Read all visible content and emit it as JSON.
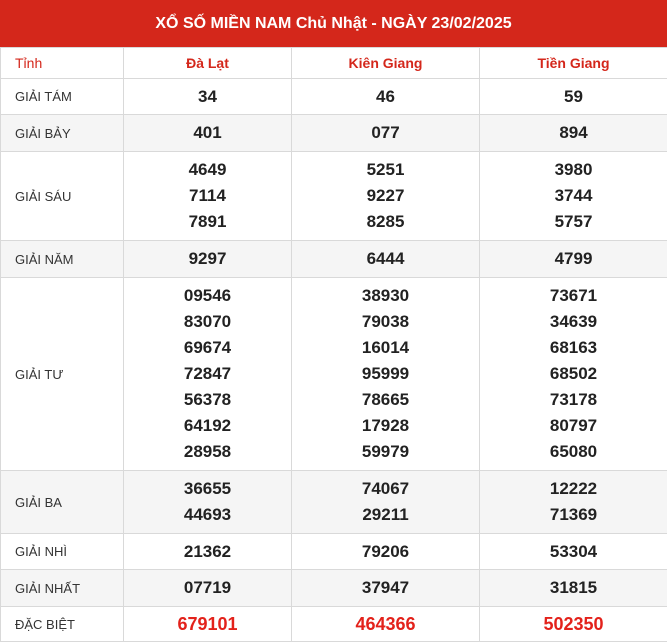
{
  "header": {
    "title": "XỔ SỐ MIỀN NAM Chủ Nhật - NGÀY 23/02/2025"
  },
  "columns": {
    "label": "Tỉnh",
    "provinces": [
      "Đà Lạt",
      "Kiên Giang",
      "Tiền Giang"
    ]
  },
  "rows": [
    {
      "label": "GIẢI TÁM",
      "values": [
        [
          "34"
        ],
        [
          "46"
        ],
        [
          "59"
        ]
      ]
    },
    {
      "label": "GIẢI BẢY",
      "values": [
        [
          "401"
        ],
        [
          "077"
        ],
        [
          "894"
        ]
      ]
    },
    {
      "label": "GIẢI SÁU",
      "values": [
        [
          "4649",
          "7114",
          "7891"
        ],
        [
          "5251",
          "9227",
          "8285"
        ],
        [
          "3980",
          "3744",
          "5757"
        ]
      ]
    },
    {
      "label": "GIẢI NĂM",
      "values": [
        [
          "9297"
        ],
        [
          "6444"
        ],
        [
          "4799"
        ]
      ]
    },
    {
      "label": "GIẢI TƯ",
      "values": [
        [
          "09546",
          "83070",
          "69674",
          "72847",
          "56378",
          "64192",
          "28958"
        ],
        [
          "38930",
          "79038",
          "16014",
          "95999",
          "78665",
          "17928",
          "59979"
        ],
        [
          "73671",
          "34639",
          "68163",
          "68502",
          "73178",
          "80797",
          "65080"
        ]
      ]
    },
    {
      "label": "GIẢI BA",
      "values": [
        [
          "36655",
          "44693"
        ],
        [
          "74067",
          "29211"
        ],
        [
          "12222",
          "71369"
        ]
      ]
    },
    {
      "label": "GIẢI NHÌ",
      "values": [
        [
          "21362"
        ],
        [
          "79206"
        ],
        [
          "53304"
        ]
      ]
    },
    {
      "label": "GIẢI NHẤT",
      "values": [
        [
          "07719"
        ],
        [
          "37947"
        ],
        [
          "31815"
        ]
      ]
    },
    {
      "label": "ĐẶC BIỆT",
      "values": [
        [
          "679101"
        ],
        [
          "464366"
        ],
        [
          "502350"
        ]
      ]
    }
  ],
  "colors": {
    "header_bg": "#d4271b",
    "province_text": "#d4271b",
    "special_text": "#e3221b",
    "alt_row_bg": "#f5f5f5"
  }
}
